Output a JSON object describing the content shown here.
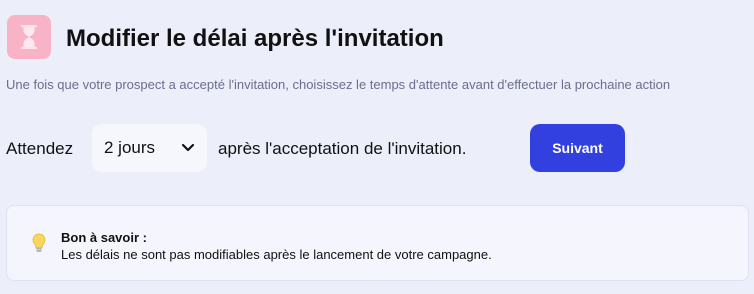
{
  "header": {
    "icon": "hourglass-icon",
    "title": "Modifier le délai après l'invitation",
    "subtitle": "Une fois que votre prospect a accepté l'invitation, choisissez le temps d'attente avant d'effectuer la prochaine action"
  },
  "delay_row": {
    "prefix": "Attendez",
    "select_value": "2 jours",
    "select_icon": "chevron-down-icon",
    "suffix": "après l'acceptation de l'invitation.",
    "next_button": "Suivant"
  },
  "tip": {
    "icon": "lightbulb-icon",
    "title": "Bon à savoir :",
    "text": "Les délais ne sont pas modifiables après le lancement de votre campagne."
  },
  "colors": {
    "background": "#eceefa",
    "icon_box": "#f9b3c6",
    "primary_button": "#3340e0",
    "subtitle": "#6b6e8c"
  }
}
